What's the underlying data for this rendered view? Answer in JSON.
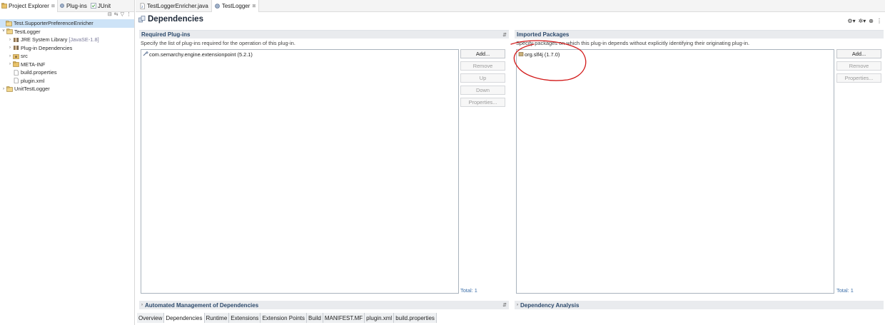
{
  "left_panel": {
    "tabs": [
      {
        "label": "Project Explorer",
        "active": true
      },
      {
        "label": "Plug-ins",
        "active": false
      },
      {
        "label": "JUnit",
        "active": false
      }
    ],
    "tree": [
      {
        "label": "Test.SupporterPreferenceEnricher",
        "selected": true,
        "icon": "project-icon"
      },
      {
        "label": "TestLogger",
        "icon": "project-icon"
      },
      {
        "label": "JRE System Library",
        "decoration": "[JavaSE-1.8]",
        "icon": "library-icon"
      },
      {
        "label": "Plug-in Dependencies",
        "icon": "library-icon"
      },
      {
        "label": "src",
        "icon": "source-folder-icon"
      },
      {
        "label": "META-INF",
        "icon": "folder-icon"
      },
      {
        "label": "build.properties",
        "icon": "file-icon"
      },
      {
        "label": "plugin.xml",
        "icon": "file-icon"
      },
      {
        "label": "UnitTestLogger",
        "icon": "project-icon"
      }
    ]
  },
  "editor": {
    "tabs": [
      {
        "label": "TestLoggerEnricher.java",
        "active": false
      },
      {
        "label": "TestLogger",
        "active": true
      }
    ],
    "form_title": "Dependencies",
    "required_plugins": {
      "title": "Required Plug-ins",
      "description": "Specify the list of plug-ins required for the operation of this plug-in.",
      "items": [
        "com.semarchy.engine.extensionpoint (5.2.1)"
      ],
      "buttons": {
        "add": "Add...",
        "remove": "Remove",
        "up": "Up",
        "down": "Down",
        "properties": "Properties..."
      },
      "total": "Total: 1"
    },
    "imported_packages": {
      "title": "Imported Packages",
      "description": "Specify packages on which this plug-in depends without explicitly identifying their originating plug-in.",
      "items": [
        "org.slf4j (1.7.0)"
      ],
      "buttons": {
        "add": "Add...",
        "remove": "Remove",
        "properties": "Properties..."
      },
      "total": "Total: 1"
    },
    "automated_management": {
      "title": "Automated Management of Dependencies"
    },
    "dependency_analysis": {
      "title": "Dependency Analysis"
    },
    "page_tabs": [
      "Overview",
      "Dependencies",
      "Runtime",
      "Extensions",
      "Extension Points",
      "Build",
      "MANIFEST.MF",
      "plugin.xml",
      "build.properties"
    ],
    "active_page_tab": "Dependencies"
  },
  "colors": {
    "section_title": "#2d4a6c",
    "link_total": "#3b6ea8",
    "annotation_ink": "#d21a1a",
    "selection": "#cde3f7"
  }
}
